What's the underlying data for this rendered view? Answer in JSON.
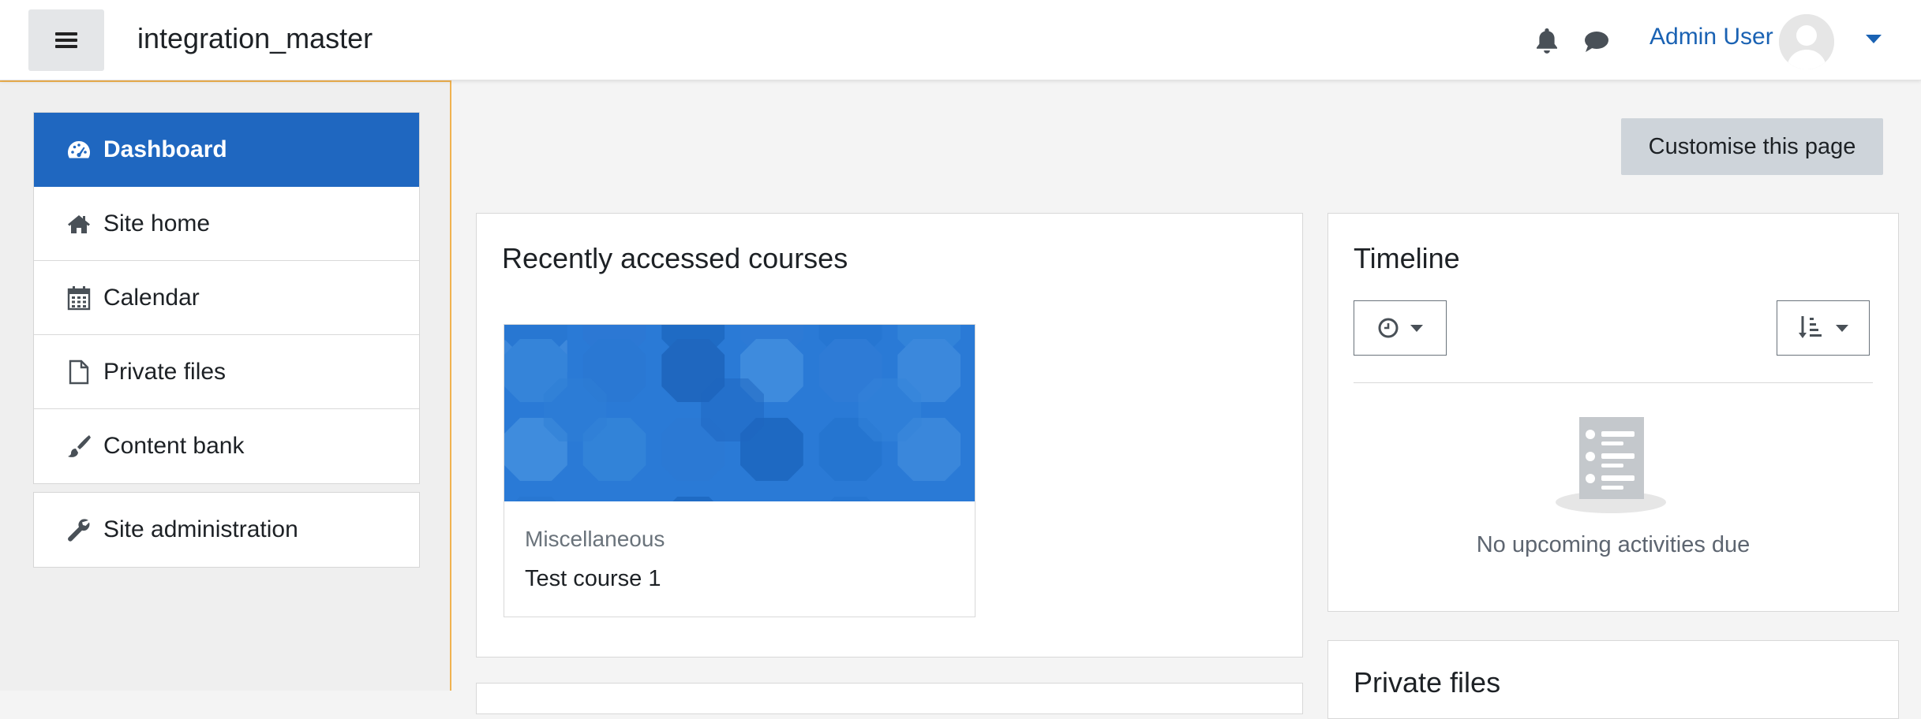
{
  "header": {
    "site_title": "integration_master",
    "user_name": "Admin User",
    "icons": [
      "hamburger-menu-icon",
      "bell-icon",
      "chat-icon",
      "avatar",
      "chevron-down-icon"
    ]
  },
  "nav": {
    "items": [
      {
        "label": "Dashboard",
        "icon": "dashboard-icon",
        "active": true
      },
      {
        "label": "Site home",
        "icon": "home-icon"
      },
      {
        "label": "Calendar",
        "icon": "calendar-icon"
      },
      {
        "label": "Private files",
        "icon": "file-icon"
      },
      {
        "label": "Content bank",
        "icon": "paintbrush-icon"
      }
    ],
    "admin": {
      "label": "Site administration",
      "icon": "wrench-icon"
    }
  },
  "main": {
    "customise_label": "Customise this page",
    "recent": {
      "title": "Recently accessed courses",
      "courses": [
        {
          "category": "Miscellaneous",
          "name": "Test course 1"
        }
      ]
    },
    "timeline": {
      "title": "Timeline",
      "empty_text": "No upcoming activities due"
    },
    "private_files": {
      "title": "Private files"
    }
  },
  "colors": {
    "brand_blue": "#1f67c0",
    "drawer_border": "#f0b250",
    "link_blue": "#1a62b3"
  }
}
